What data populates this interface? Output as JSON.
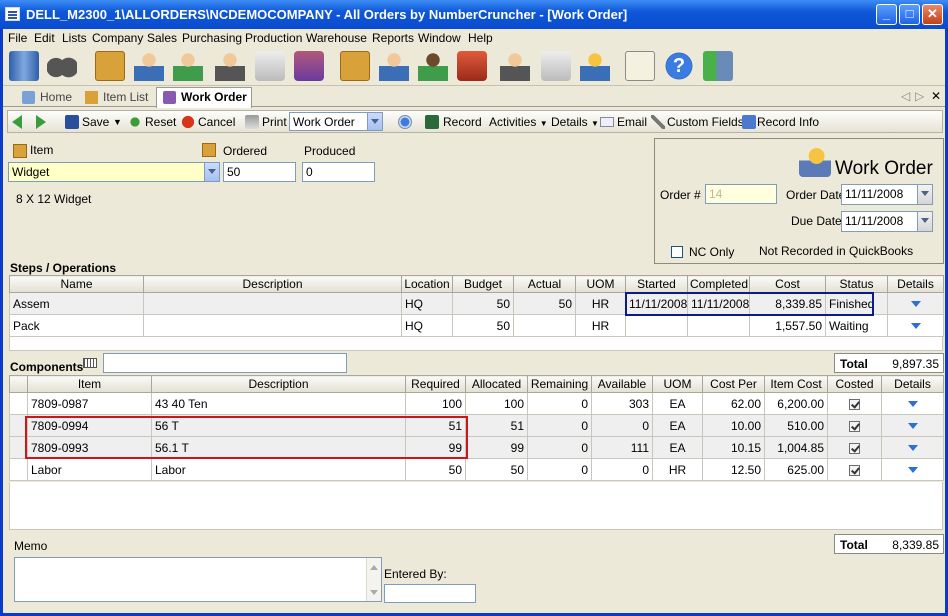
{
  "window": {
    "title": "DELL_M2300_1\\ALLORDERS\\NCDEMOCOMPANY - All Orders by NumberCruncher - [Work Order]",
    "min": "_",
    "max": "□",
    "close": "✕"
  },
  "menu": [
    "File",
    "Edit",
    "Lists",
    "Company",
    "Sales",
    "Purchasing",
    "Production",
    "Warehouse",
    "Reports",
    "Window",
    "Help"
  ],
  "tabs": {
    "home": "Home",
    "item_list": "Item List",
    "work_order": "Work Order"
  },
  "tab_nav": {
    "prev": "◁",
    "next": "▷",
    "close": "✕"
  },
  "cmd": {
    "save": "Save",
    "reset": "Reset",
    "cancel": "Cancel",
    "print": "Print",
    "print_select": "Work Order",
    "record": "Record",
    "activities": "Activities",
    "details": "Details",
    "email": "Email",
    "custom_fields": "Custom Fields",
    "record_info": "Record Info"
  },
  "header": {
    "item_label": "Item",
    "item_value": "Widget",
    "ordered_label": "Ordered",
    "ordered_value": "50",
    "produced_label": "Produced",
    "produced_value": "0",
    "item_description": "8 X 12 Widget"
  },
  "wo": {
    "heading": "Work Order",
    "order_no_label": "Order #",
    "order_no_value": "14",
    "order_date_label": "Order Date",
    "order_date_value": "11/11/2008",
    "due_date_label": "Due Date",
    "due_date_value": "11/11/2008",
    "nc_only_label": "NC Only",
    "qb_status": "Not Recorded in QuickBooks"
  },
  "steps": {
    "section_label": "Steps / Operations",
    "columns": [
      "Name",
      "Description",
      "Location",
      "Budget",
      "Actual",
      "UOM",
      "Started",
      "Completed",
      "Cost",
      "Status",
      "Details"
    ],
    "rows": [
      [
        "Assem",
        "",
        "HQ",
        "50",
        "50",
        "HR",
        "11/11/2008",
        "11/11/2008",
        "8,339.85",
        "Finished",
        ""
      ],
      [
        "Pack",
        "",
        "HQ",
        "50",
        "",
        "HR",
        "",
        "",
        "1,557.50",
        "Waiting",
        ""
      ]
    ],
    "total_label": "Total",
    "total_value": "9,897.35"
  },
  "components": {
    "section_label": "Components",
    "columns": [
      "Item",
      "Description",
      "Required",
      "Allocated",
      "Remaining",
      "Available",
      "UOM",
      "Cost Per",
      "Item Cost",
      "Costed",
      "Details"
    ],
    "rows": [
      [
        "7809-0987",
        "43 40 Ten",
        "100",
        "100",
        "0",
        "303",
        "EA",
        "62.00",
        "6,200.00",
        "",
        ""
      ],
      [
        "7809-0994",
        "56 T",
        "51",
        "51",
        "0",
        "0",
        "EA",
        "10.00",
        "510.00",
        "",
        ""
      ],
      [
        "7809-0993",
        "56.1 T",
        "99",
        "99",
        "0",
        "111",
        "EA",
        "10.15",
        "1,004.85",
        "",
        ""
      ],
      [
        "Labor",
        "Labor",
        "50",
        "50",
        "0",
        "0",
        "HR",
        "12.50",
        "625.00",
        "",
        ""
      ]
    ],
    "total_label": "Total",
    "total_value": "8,339.85"
  },
  "memo": {
    "label": "Memo",
    "entered_by_label": "Entered By:"
  },
  "colors": {
    "highlight_blue": "#0a1c8c",
    "highlight_red": "#d0141c",
    "title_blue": "#0a4bd0"
  }
}
